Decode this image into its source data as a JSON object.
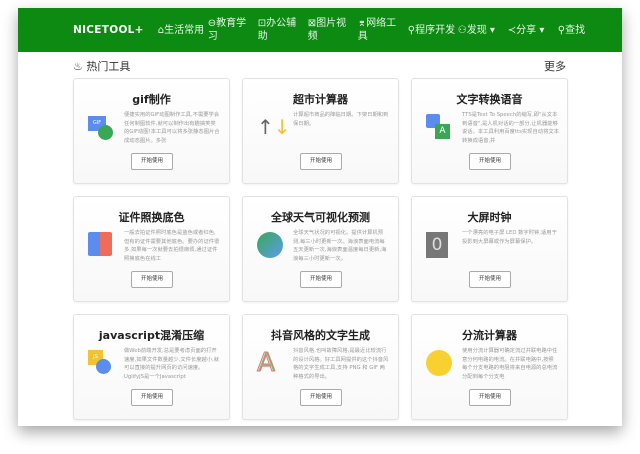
{
  "nav": {
    "logo": "NICETOOL+",
    "items": [
      "⌂生活常用",
      "⊖教育学习",
      "⊡办公辅助",
      "⊠图片视频",
      "⌆网络工具",
      "⚲程序开发",
      "⚇发现 ▾",
      "≺分享 ▾",
      "⚲查找"
    ]
  },
  "section": {
    "title": "热门工具",
    "more": "更多",
    "icon": "fire-icon"
  },
  "cards": [
    {
      "title": "gif制作",
      "desc": "便捷实用的GIF动图制作工具,不需要学会任何制图软件,就可以制作出有趣搞笑类的GIF动图!本工具可以将多张静态图片合成动态图片。多张",
      "button": "开始使用",
      "icon": "gif-icon"
    },
    {
      "title": "超市计算器",
      "desc": "计算超市商品的降临日期。下架日期和到保日期。",
      "button": "开始使用",
      "icon": "sort-arrows-icon"
    },
    {
      "title": "文字转换语音",
      "desc": "TTS是Text To Speech的缩写,即\"从文本到语音\",是人机对话的一部分,让机器能够说话。本工具利用百度tts实现自动将文本转换成语音,并",
      "button": "开始使用",
      "icon": "text-to-speech-icon"
    },
    {
      "title": "证件照换底色",
      "desc": "一般去拍证件照时底色是蓝色或者红色,但有的证件需要其他底色。要办的证件很多,如果每一次就要去拍很麻烦,通过证件照换底色在线工",
      "button": "开始使用",
      "icon": "id-photo-icon"
    },
    {
      "title": "全球天气可视化预测",
      "desc": "全球天气状况的可视化。提供计算机预测,每三小时更新一次。海浪表面电流每五天更新一次,海浪表面温度每日更新,海浪每三小时更新一次。",
      "button": "开始使用",
      "icon": "globe-icon"
    },
    {
      "title": "大屏时钟",
      "desc": "一个漂亮的电子屏 LED 数字时钟,适用于投影到大屏幕或作为屏幕保护。",
      "button": "开始使用",
      "icon": "led-clock-icon"
    },
    {
      "title": "javascript混淆压缩",
      "desc": "做Web前端开发,总是要考虑页面的打开速度,如果文件数量越少,文件长度越小,就可以直接的提升网页的访问速度。UglifyJS是一个Javascript",
      "button": "开始使用",
      "icon": "js-icon"
    },
    {
      "title": "抖音风格的文字生成",
      "desc": "抖音风格,也叫故障风格,是最近比较流行的设计风格。好工具网提供的这个抖音风格的文字生成工具,支持 PNG 和 GIF 两种格式的导出。",
      "button": "开始使用",
      "icon": "glitch-letter-icon"
    },
    {
      "title": "分流计算器",
      "desc": "使用分流计算器可确定流过并联电路中任意分何电路的电流。在并联电路中,按照每个分支电路的电阻将来自电源的总电流分配到每个分支电",
      "button": "开始使用",
      "icon": "calculator-icon"
    }
  ]
}
